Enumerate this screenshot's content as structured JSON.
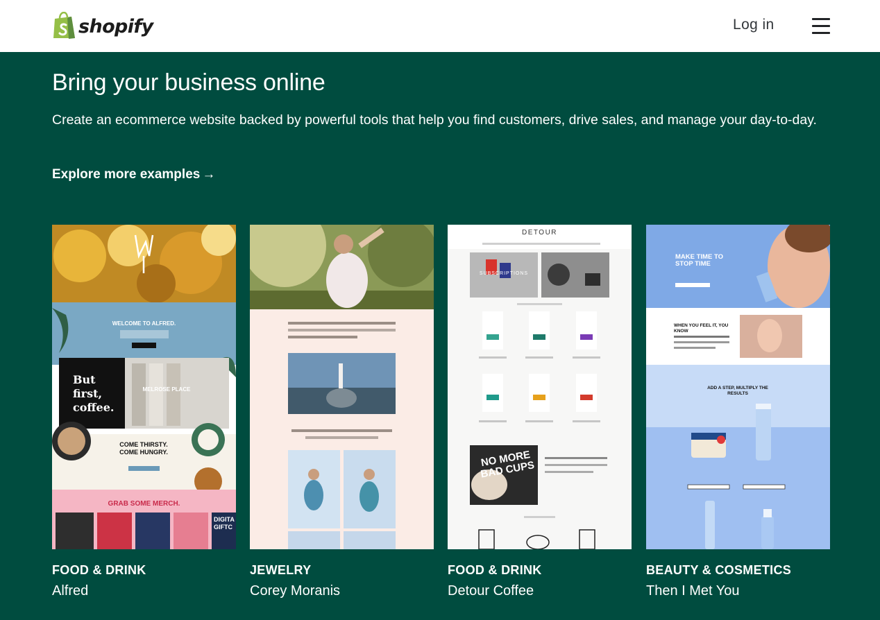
{
  "header": {
    "brand": "shopify",
    "login_label": "Log in"
  },
  "hero": {
    "title": "Bring your business online",
    "subtitle": "Create an ecommerce website backed by powerful tools that help you find customers, drive sales, and manage your day-to-day.",
    "explore_label": "Explore more examples",
    "explore_arrow": "→"
  },
  "examples": [
    {
      "category": "FOOD & DRINK",
      "name": "Alfred",
      "shot": {
        "welcome": "WELCOME TO ALFRED.",
        "but_first": "But first, coffee.",
        "melrose": "MELROSE PLACE",
        "come_thirsty": "COME THIRSTY. COME HUNGRY.",
        "grab_merch": "GRAB SOME MERCH.",
        "digital_gift": "DIGITA GIFTC"
      }
    },
    {
      "category": "JEWELRY",
      "name": "Corey Moranis",
      "shot": {}
    },
    {
      "category": "FOOD & DRINK",
      "name": "Detour Coffee",
      "shot": {
        "brand": "DETOUR",
        "subscriptions": "SUBSCRIPTIONS",
        "no_more_bad_cups": "NO MORE BAD CUPS"
      }
    },
    {
      "category": "BEAUTY & COSMETICS",
      "name": "Then I Met You",
      "shot": {
        "make_time": "MAKE TIME TO STOP TIME",
        "when_you_feel": "WHEN YOU FEEL IT, YOU KNOW",
        "add_a_step": "ADD A STEP, MULTIPLY THE RESULTS"
      }
    }
  ],
  "icons": {
    "logo": "shopify-bag-icon",
    "menu": "hamburger-menu-icon"
  },
  "colors": {
    "hero_bg": "#004c3f",
    "logo_green": "#95bf47",
    "logo_dark_green": "#5e8e3e"
  }
}
